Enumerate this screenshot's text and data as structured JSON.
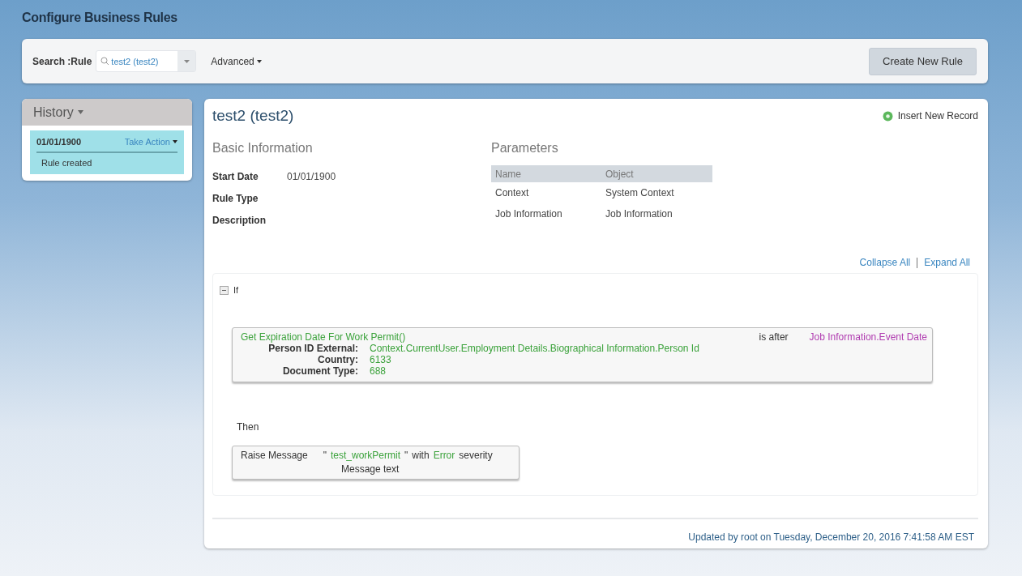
{
  "page_title": "Configure Business Rules",
  "search": {
    "label": "Search :Rule",
    "value": "test2 (test2)"
  },
  "advanced_menu": {
    "label": "Advanced"
  },
  "create_button": {
    "label": "Create New Rule"
  },
  "history": {
    "title": "History",
    "entries": [
      {
        "date": "01/01/1900",
        "action": "Take Action",
        "text": "Rule created",
        "selected": true
      }
    ]
  },
  "rule": {
    "title": "test2 (test2)",
    "insert_link": "Insert New Record",
    "basic_information": {
      "heading": "Basic Information",
      "fields": [
        {
          "label": "Start Date",
          "value": "01/01/1900"
        },
        {
          "label": "Rule Type"
        },
        {
          "label": "Description"
        }
      ]
    },
    "parameters": {
      "heading": "Parameters",
      "columns": [
        "Name",
        "Object"
      ],
      "rows": [
        [
          "Context",
          "System Context"
        ],
        [
          "Job Information",
          "Job Information"
        ]
      ]
    },
    "collapse_all": "Collapse All",
    "expand_all": "Expand All",
    "if_block": {
      "label": "If",
      "expanded": true,
      "condition": {
        "function": "Get Expiration Date For Work Permit()",
        "operator": "is after",
        "target": "Job Information.Event Date",
        "arguments": [
          {
            "label": "Person ID External:",
            "value": "Context.CurrentUser.Employment Details.Biographical Information.Person Id"
          },
          {
            "label": "Country:",
            "value": "6133"
          },
          {
            "label": "Document Type:",
            "value": "688"
          }
        ]
      }
    },
    "then_block": {
      "label": "Then",
      "action": {
        "name": "Raise Message",
        "open_quote": "\"",
        "message": "test_workPermit",
        "close_quote": "\"",
        "joiner": "with",
        "severity": "Error",
        "suffix": "severity",
        "caption": "Message text"
      }
    },
    "footer": "Updated by root on Tuesday, December 20, 2016 7:41:58 AM EST"
  }
}
